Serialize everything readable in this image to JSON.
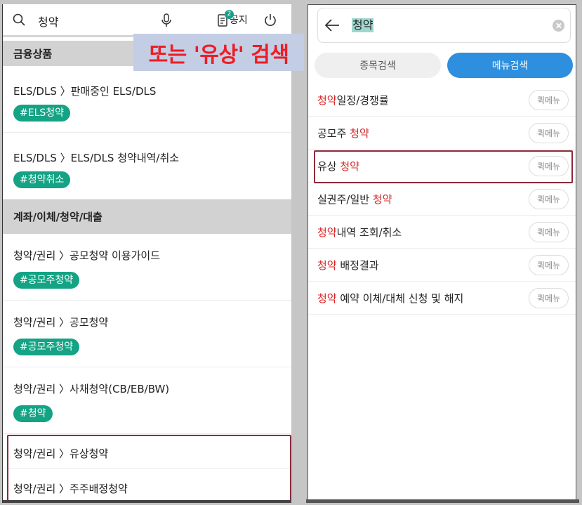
{
  "left": {
    "search_query": "청약",
    "notice_badge": "2",
    "notice_label": "공지",
    "sections": [
      {
        "title": "금융상품"
      },
      {
        "title": "계좌/이체/청약/대출"
      }
    ],
    "items": [
      {
        "path": "ELS/DLS 〉판매중인 ELS/DLS",
        "tag": "#ELS청약"
      },
      {
        "path": "ELS/DLS 〉ELS/DLS 청약내역/취소",
        "tag": "#청약취소"
      },
      {
        "path": "청약/권리 〉공모청약 이용가이드",
        "tag": "#공모주청약"
      },
      {
        "path": "청약/권리 〉공모청약",
        "tag": "#공모주청약"
      },
      {
        "path": "청약/권리 〉사채청약(CB/EB/BW)",
        "tag": "#청약"
      },
      {
        "path": "청약/권리 〉유상청약"
      },
      {
        "path": "청약/권리 〉주주배정청약"
      }
    ]
  },
  "callout": {
    "text": "또는 '유상' 검색"
  },
  "right": {
    "search_query": "청약",
    "tabs": [
      {
        "label": "종목검색",
        "active": false
      },
      {
        "label": "메뉴검색",
        "active": true
      }
    ],
    "quick_label": "퀵메뉴",
    "results": [
      {
        "hl": "청약",
        "rest": "일정/경쟁률",
        "hl_first": true
      },
      {
        "pre": "공모주 ",
        "hl": "청약",
        "hl_first": false
      },
      {
        "pre": "유상 ",
        "hl": "청약",
        "hl_first": false
      },
      {
        "pre": "실권주/일반 ",
        "hl": "청약",
        "hl_first": false
      },
      {
        "hl": "청약",
        "rest": "내역 조회/취소",
        "hl_first": true
      },
      {
        "hl": "청약",
        "rest": " 배정결과",
        "hl_first": true
      },
      {
        "hl": "청약",
        "rest": " 예약 이체/대체 신청 및 해지",
        "hl_first": true
      }
    ]
  },
  "colors": {
    "tag_green": "#14a384",
    "active_tab_blue": "#2d8fde",
    "highlight_red": "#d42828",
    "callout_red": "#ee1c24",
    "box_border": "#8a2b3b"
  },
  "icons": {
    "left_search": "search-icon",
    "mic": "microphone-icon",
    "notice": "notice-document-icon",
    "power": "power-icon",
    "back": "back-arrow-icon",
    "clear": "clear-icon"
  }
}
